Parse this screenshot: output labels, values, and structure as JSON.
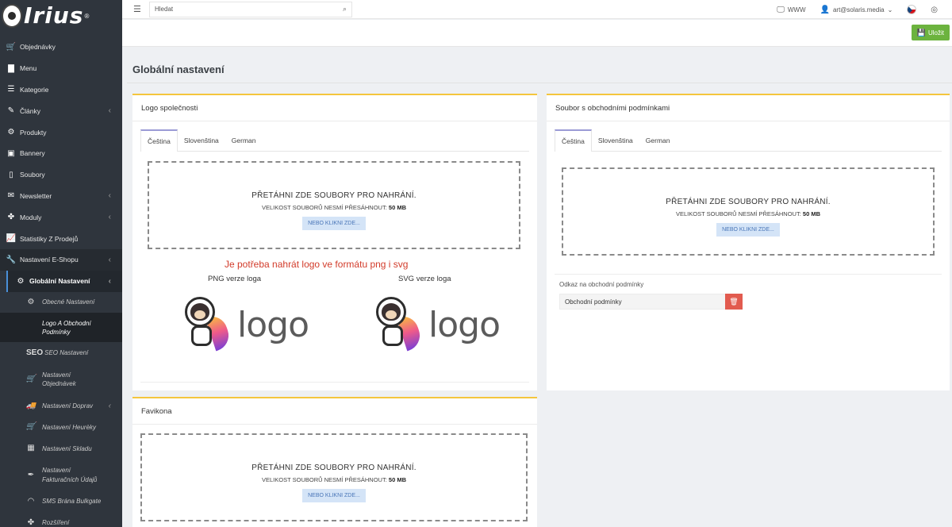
{
  "app": {
    "brand": "Irius",
    "brand_mark": "®"
  },
  "sidebar": {
    "items": [
      {
        "label": "Objednávky",
        "icon": "cart-icon",
        "chevron": false
      },
      {
        "label": "Menu",
        "icon": "folder-icon",
        "chevron": false
      },
      {
        "label": "Kategorie",
        "icon": "list-icon",
        "chevron": false
      },
      {
        "label": "Články",
        "icon": "pen-icon",
        "chevron": true
      },
      {
        "label": "Produkty",
        "icon": "cube-icon",
        "chevron": false
      },
      {
        "label": "Bannery",
        "icon": "image-icon",
        "chevron": false
      },
      {
        "label": "Soubory",
        "icon": "file-icon",
        "chevron": false
      },
      {
        "label": "Newsletter",
        "icon": "mail-icon",
        "chevron": true
      },
      {
        "label": "Moduly",
        "icon": "puzzle-icon",
        "chevron": true
      },
      {
        "label": "Statistiky Z Prodejů",
        "icon": "chart-icon",
        "chevron": false
      },
      {
        "label": "Nastavení E-Shopu",
        "icon": "wrench-icon",
        "chevron": true
      }
    ],
    "active_parent": {
      "label": "Globální Nastavení",
      "icon": "gear-icon"
    },
    "sub_items": [
      {
        "label": "Obecné Nastavení",
        "icon": "gear-icon"
      },
      {
        "label": "Logo A Obchodní Podmínky",
        "icon": "",
        "current": true
      },
      {
        "label": "SEO Nastavení",
        "icon": "seo-icon",
        "icon_text": "SEO"
      },
      {
        "label": "Nastavení Objednávek",
        "icon": "cart-icon"
      },
      {
        "label": "Nastavení Doprav",
        "icon": "truck-icon",
        "chevron": true
      },
      {
        "label": "Nastavení Heurèky",
        "icon": "cart-icon"
      },
      {
        "label": "Nastavení Skladu",
        "icon": "box-icon"
      },
      {
        "label": "Nastavení Fakturačních Údajů",
        "icon": "feather-icon"
      },
      {
        "label": "SMS Brána Bulkgate",
        "icon": "signal-icon"
      },
      {
        "label": "Rozšíření",
        "icon": "puzzle-icon"
      }
    ]
  },
  "topbar": {
    "search_placeholder": "Hledat",
    "www_label": "WWW",
    "user_email": "art@solaris.media"
  },
  "actionbar": {
    "save_label": "Uložit"
  },
  "page": {
    "title": "Globální nastavení"
  },
  "logo_card": {
    "title": "Logo společnosti",
    "tabs": [
      "Čeština",
      "Slovenština",
      "German"
    ],
    "active_tab": 0,
    "dropzone": {
      "title": "PŘETÁHNI ZDE SOUBORY PRO NAHRÁNÍ.",
      "size_text": "VELIKOST SOUBORŮ NESMÍ PŘESÁHNOUT: ",
      "size_value": "50 MB",
      "button": "NEBO KLIKNI ZDE..."
    },
    "note": "Je potřeba nahrát logo ve formátu png i svg",
    "png_label": "PNG verze loga",
    "svg_label": "SVG verze loga",
    "logo_word": "logo"
  },
  "terms_card": {
    "title": "Soubor s obchodními podmínkami",
    "tabs": [
      "Čeština",
      "Slovenština",
      "German"
    ],
    "active_tab": 0,
    "dropzone": {
      "title": "PŘETÁHNI ZDE SOUBORY PRO NAHRÁNÍ.",
      "size_text": "VELIKOST SOUBORŮ NESMÍ PŘESÁHNOUT: ",
      "size_value": "50 MB",
      "button": "NEBO KLIKNI ZDE..."
    },
    "link_label": "Odkaz na obchodní podmínky",
    "link_value": "Obchodní podmínky"
  },
  "favicon_card": {
    "title": "Favikona",
    "dropzone": {
      "title": "PŘETÁHNI ZDE SOUBORY PRO NAHRÁNÍ.",
      "size_text": "VELIKOST SOUBORŮ NESMÍ PŘESÁHNOUT: ",
      "size_value": "50 MB",
      "button": "NEBO KLIKNI ZDE..."
    }
  },
  "colors": {
    "sidebar_bg": "#2f353d",
    "accent_yellow": "#f4c63d",
    "save_green": "#6cb33e",
    "note_red": "#d23b2a",
    "delete_red": "#e25b4f"
  }
}
